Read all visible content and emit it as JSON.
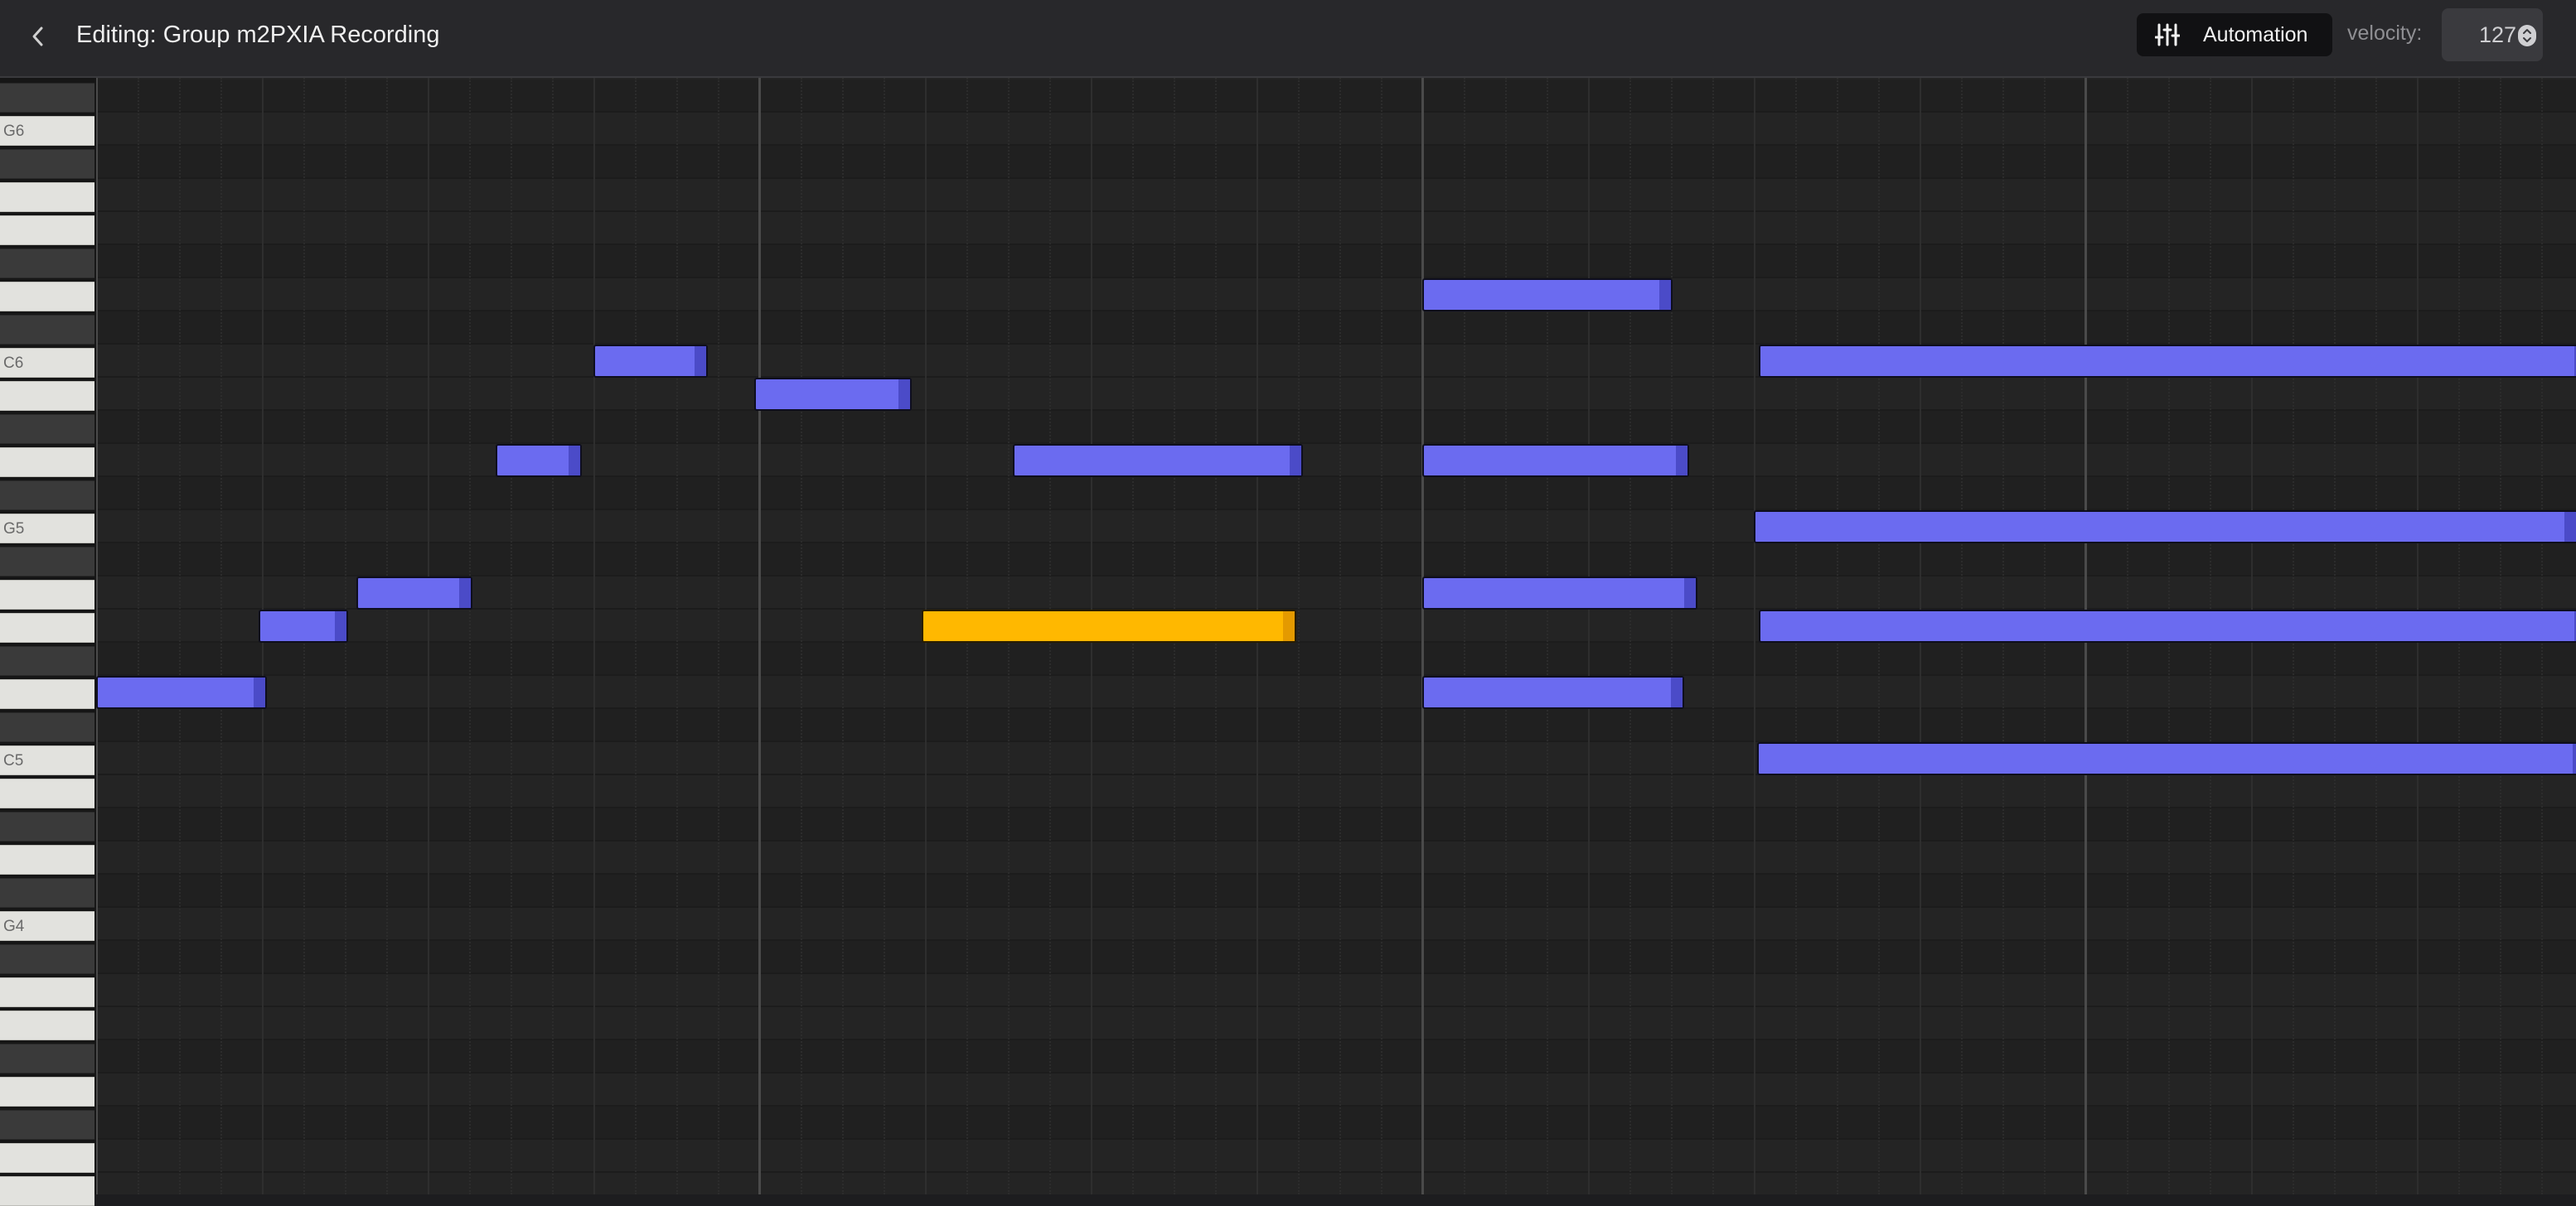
{
  "header": {
    "title": "Editing: Group m2PXIA Recording",
    "back_icon": "chevron-left-icon",
    "automation_label": "Automation",
    "automation_icon": "sliders-icon",
    "velocity_label": "velocity:",
    "velocity_value": "127"
  },
  "piano": {
    "octave_labels": [
      "G6",
      "C6",
      "G5",
      "C5",
      "G4"
    ]
  },
  "colors": {
    "note": "#6b6bf0",
    "note_selected": "#ffb800",
    "background": "#242424",
    "header": "#28282b"
  },
  "notes": [
    {
      "pitch": "C6",
      "start": 3.0,
      "length": 0.69
    },
    {
      "pitch": "B5",
      "start": 3.97,
      "length": 0.95
    },
    {
      "pitch": "A5",
      "start": 2.41,
      "length": 0.52
    },
    {
      "pitch": "A5",
      "start": 5.53,
      "length": 1.75
    },
    {
      "pitch": "F5",
      "start": 1.57,
      "length": 0.7
    },
    {
      "pitch": "E5",
      "start": 0.98,
      "length": 0.54
    },
    {
      "pitch": "E5",
      "start": 4.98,
      "length": 2.26,
      "selected": true
    },
    {
      "pitch": "D5",
      "start": 0.0,
      "length": 1.03
    },
    {
      "pitch": "D6",
      "start": 8.0,
      "length": 1.51
    },
    {
      "pitch": "A5",
      "start": 8.0,
      "length": 1.61
    },
    {
      "pitch": "F5",
      "start": 8.0,
      "length": 1.66
    },
    {
      "pitch": "D5",
      "start": 8.0,
      "length": 1.58
    },
    {
      "pitch": "C6",
      "start": 10.03,
      "length": 5.0
    },
    {
      "pitch": "G5",
      "start": 10.0,
      "length": 4.97
    },
    {
      "pitch": "E5",
      "start": 10.03,
      "length": 5.0
    },
    {
      "pitch": "C5",
      "start": 10.02,
      "length": 5.0
    }
  ]
}
